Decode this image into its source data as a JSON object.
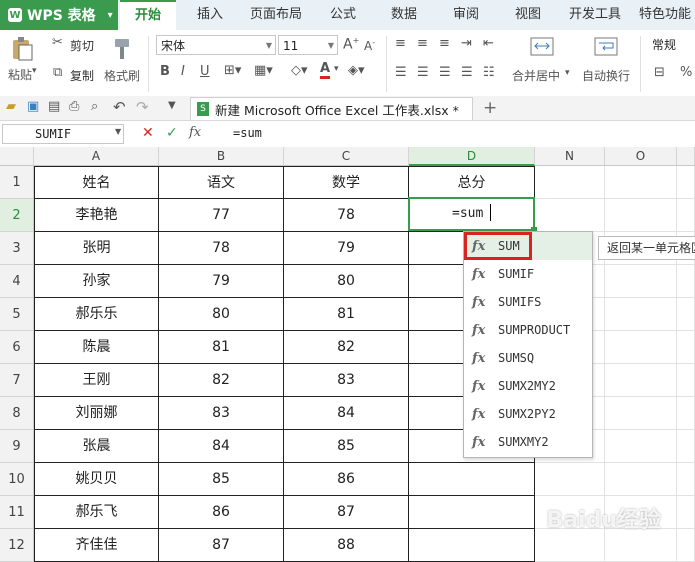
{
  "app": {
    "name": "WPS 表格",
    "logo_letter": "W"
  },
  "tabs": [
    "开始",
    "插入",
    "页面布局",
    "公式",
    "数据",
    "审阅",
    "视图",
    "开发工具",
    "特色功能"
  ],
  "ribbon": {
    "cut": "剪切",
    "paste": "粘贴",
    "copy": "复制",
    "format_painter": "格式刷",
    "font_name": "宋体",
    "font_size": "11",
    "merge_center": "合并居中",
    "wrap_text": "自动换行",
    "number_format": "常规"
  },
  "document": {
    "title": "新建 Microsoft Office Excel 工作表.xlsx *"
  },
  "formula_bar": {
    "name_box": "SUMIF",
    "fx": "fx",
    "content": "=sum"
  },
  "grid": {
    "columns": [
      "A",
      "B",
      "C",
      "D",
      "N",
      "O"
    ],
    "row_numbers": [
      "1",
      "2",
      "3",
      "4",
      "5",
      "6",
      "7",
      "8",
      "9",
      "10",
      "11",
      "12"
    ],
    "header": [
      "姓名",
      "语文",
      "数学",
      "总分"
    ],
    "rows": [
      [
        "李艳艳",
        "77",
        "78"
      ],
      [
        "张明",
        "78",
        "79"
      ],
      [
        "孙家",
        "79",
        "80"
      ],
      [
        "郝乐乐",
        "80",
        "81"
      ],
      [
        "陈晨",
        "81",
        "82"
      ],
      [
        "王刚",
        "82",
        "83"
      ],
      [
        "刘丽娜",
        "83",
        "84"
      ],
      [
        "张晨",
        "84",
        "85"
      ],
      [
        "姚贝贝",
        "85",
        "86"
      ],
      [
        "郝乐飞",
        "86",
        "87"
      ],
      [
        "齐佳佳",
        "87",
        "88"
      ]
    ],
    "editing_value": "=sum"
  },
  "autocomplete": [
    "SUM",
    "SUMIF",
    "SUMIFS",
    "SUMPRODUCT",
    "SUMSQ",
    "SUMX2MY2",
    "SUMX2PY2",
    "SUMXMY2"
  ],
  "tooltip": "返回某一单元格区",
  "watermark": "Baidu经验",
  "colors": {
    "accent": "#3a9a4e",
    "selection_red": "#d9231f"
  }
}
